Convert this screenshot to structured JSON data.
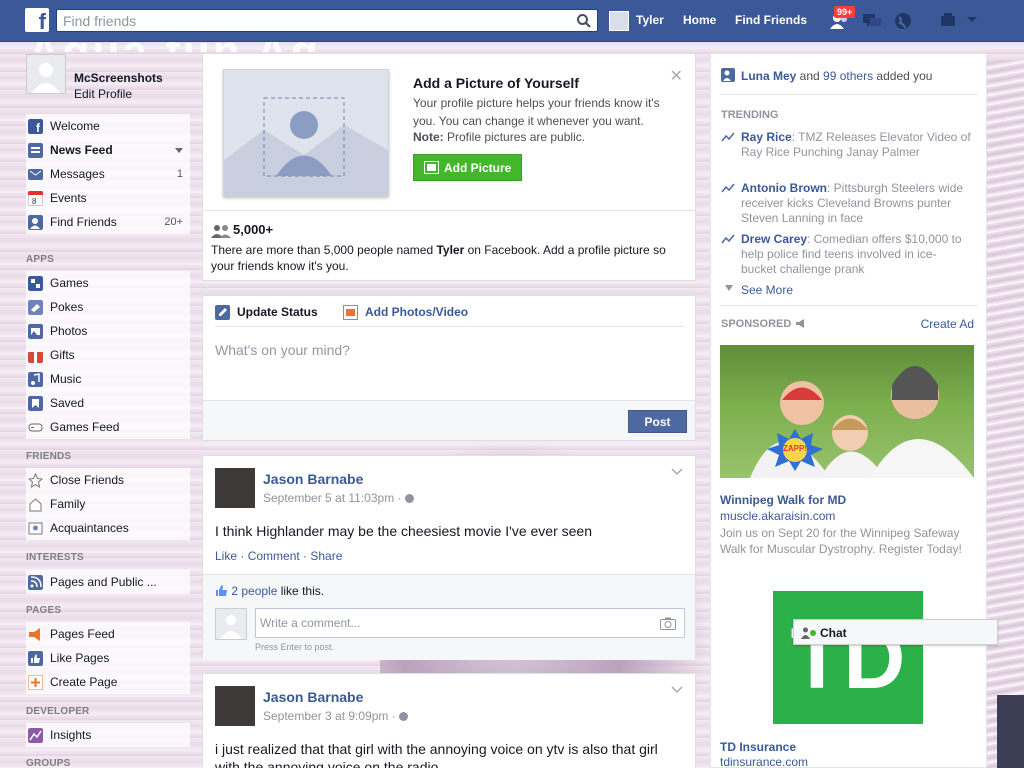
{
  "topbar": {
    "search_placeholder": "Find friends",
    "user_name": "Tyler",
    "home": "Home",
    "find_friends": "Find Friends",
    "notif_count": "99+"
  },
  "background": {
    "banner_text": "Aqua fun Ag"
  },
  "left": {
    "profile_name": "McScreenshots",
    "edit_profile": "Edit Profile",
    "main_items": [
      {
        "label": "Welcome",
        "icon": "facebook-icon"
      },
      {
        "label": "News Feed",
        "icon": "news-feed-icon"
      },
      {
        "label": "Messages",
        "icon": "messages-icon",
        "count": "1"
      },
      {
        "label": "Events",
        "icon": "calendar-icon"
      },
      {
        "label": "Find Friends",
        "icon": "find-friends-icon",
        "count": "20+"
      }
    ],
    "apps_title": "APPS",
    "apps": [
      {
        "label": "Games",
        "icon": "games-icon"
      },
      {
        "label": "Pokes",
        "icon": "pokes-icon"
      },
      {
        "label": "Photos",
        "icon": "photos-icon"
      },
      {
        "label": "Gifts",
        "icon": "gift-icon"
      },
      {
        "label": "Music",
        "icon": "music-icon"
      },
      {
        "label": "Saved",
        "icon": "bookmark-icon"
      },
      {
        "label": "Games Feed",
        "icon": "gamepad-icon"
      }
    ],
    "friends_title": "FRIENDS",
    "friends": [
      {
        "label": "Close Friends",
        "icon": "star-icon"
      },
      {
        "label": "Family",
        "icon": "family-icon"
      },
      {
        "label": "Acquaintances",
        "icon": "acquaintances-icon"
      }
    ],
    "interests_title": "INTERESTS",
    "interests": [
      {
        "label": "Pages and Public ...",
        "icon": "rss-icon"
      }
    ],
    "pages_title": "PAGES",
    "pages": [
      {
        "label": "Pages Feed",
        "icon": "megaphone-icon"
      },
      {
        "label": "Like Pages",
        "icon": "thumbs-up-icon"
      },
      {
        "label": "Create Page",
        "icon": "plus-icon"
      }
    ],
    "developer_title": "DEVELOPER",
    "developer": [
      {
        "label": "Insights",
        "icon": "chart-icon"
      }
    ],
    "groups_title": "GROUPS"
  },
  "addpic": {
    "title": "Add a Picture of Yourself",
    "text": "Your profile picture helps your friends know it's you. You can change it whenever you want.",
    "note_label": "Note:",
    "note_text": " Profile pictures are public.",
    "button": "Add Picture",
    "people_count": "5,000+",
    "people_text_1": "There are more than 5,000 people named ",
    "people_name": "Tyler",
    "people_text_2": " on Facebook. Add a profile picture so your friends know it's you."
  },
  "composer": {
    "tab_status": "Update Status",
    "tab_photos": "Add Photos/Video",
    "placeholder": "What's on your mind?",
    "post": "Post"
  },
  "posts": [
    {
      "author": "Jason Barnabe",
      "date": "September 5 at 11:03pm · ",
      "text": "I think Highlander may be the cheesiest movie I've ever seen",
      "like": "Like",
      "comment": "Comment",
      "share": "Share",
      "likes_link": "2 people",
      "likes_suffix": " like this.",
      "comment_placeholder": "Write a comment...",
      "hint": "Press Enter to post."
    },
    {
      "author": "Jason Barnabe",
      "date": "September 3 at 9:09pm · ",
      "text": "i just realized that that girl with the annoying voice on ytv is also that girl with the annoying voice on the radio"
    }
  ],
  "right": {
    "friend_name": "Luna Mey",
    "and": " and ",
    "others": "99 others",
    "added": " added you",
    "trending_title": "TRENDING",
    "trends": [
      {
        "name": "Ray Rice",
        "text": ": TMZ Releases Elevator Video of Ray Rice Punching Janay Palmer"
      },
      {
        "name": "Antonio Brown",
        "text": ": Pittsburgh Steelers wide receiver kicks Cleveland Browns punter Steven Lanning in face"
      },
      {
        "name": "Drew Carey",
        "text": ": Comedian offers $10,000 to help police find teens involved in ice-bucket challenge prank"
      }
    ],
    "see_more": "See More",
    "sponsored_title": "SPONSORED",
    "create_ad": "Create Ad",
    "ad1_badge": "ZAPP!",
    "ad1_title": "Winnipeg Walk for MD",
    "ad1_url": "muscle.akaraisin.com",
    "ad1_desc": "Join us on Sept 20 for the Winnipeg Safeway Walk for Muscular Dystrophy. Register Today!",
    "ad2_logo": "TD",
    "ad2_title": "TD Insurance",
    "ad2_url": "tdinsurance.com"
  },
  "chat": {
    "label": "Chat"
  },
  "colors": {
    "brand": "#3b5998",
    "green": "#42b72a",
    "td_green": "#2bb04a",
    "badge_red": "#fa3e3e"
  }
}
